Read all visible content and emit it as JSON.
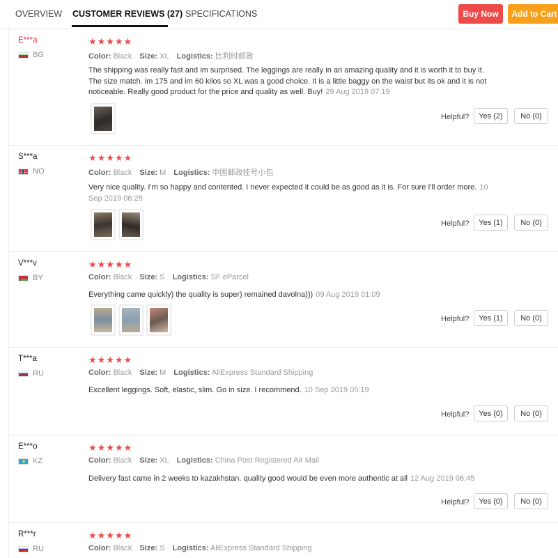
{
  "tabs": {
    "overview": "OVERVIEW",
    "reviews": "CUSTOMER REVIEWS (27)",
    "specs": "SPECIFICATIONS"
  },
  "actions": {
    "buy_now": "Buy Now",
    "add_to_cart": "Add to Cart"
  },
  "labels": {
    "color": "Color:",
    "size": "Size:",
    "logistics": "Logistics:",
    "helpful": "Helpful?"
  },
  "stars": "★★★★★",
  "reviews": [
    {
      "name": "E***a",
      "country": "BG",
      "color": "Black",
      "size": "XL",
      "logistics": "比利时邮政",
      "text": "The shipping was really fast and im surprised. The leggings are really in an amazing quality and it is worth it to buy it. The size match. im 175 and im 60 kilos so XL was a good choice. It is a little baggy on the waist but its ok and it is not noticeable. Really good product for the price and quality as well. Buy!",
      "date": "29 Aug 2019 07:19",
      "yes": "Yes (2)",
      "no": "No (0)"
    },
    {
      "name": "S***a",
      "country": "NO",
      "color": "Black",
      "size": "M",
      "logistics": "中国邮政挂号小包",
      "text": "Very nice quality. I'm so happy and contented. I never expected it could be as good as it is. For sure I'll order more.",
      "date": "10 Sep 2019 06:25",
      "yes": "Yes (1)",
      "no": "No (0)"
    },
    {
      "name": "V***v",
      "country": "BY",
      "color": "Black",
      "size": "S",
      "logistics": "SF eParcel",
      "text": "Everything came quickly) the quality is super) remained davolna)))",
      "date": "09 Aug 2019 01:09",
      "yes": "Yes (1)",
      "no": "No (0)"
    },
    {
      "name": "T***a",
      "country": "RU",
      "color": "Black",
      "size": "M",
      "logistics": "AliExpress Standard Shipping",
      "text": "Excellent leggings. Soft, elastic, slim. Go in size. I recommend.",
      "date": "10 Sep 2019 05:19",
      "yes": "Yes (0)",
      "no": "No (0)"
    },
    {
      "name": "E***o",
      "country": "KZ",
      "color": "Black",
      "size": "XL",
      "logistics": "China Post Registered Air Mail",
      "text": "Delivery fast came in 2 weeks to kazakhstan. quality good would be even more authentic at all",
      "date": "12 Aug 2019 06:45",
      "yes": "Yes (0)",
      "no": "No (0)"
    },
    {
      "name": "R***r",
      "country": "RU",
      "color": "Black",
      "size": "S",
      "logistics": "AliExpress Standard Shipping"
    }
  ],
  "colors": {
    "buy": "#ef4a4a",
    "cart": "#f8a01a",
    "star": "#f04848"
  }
}
